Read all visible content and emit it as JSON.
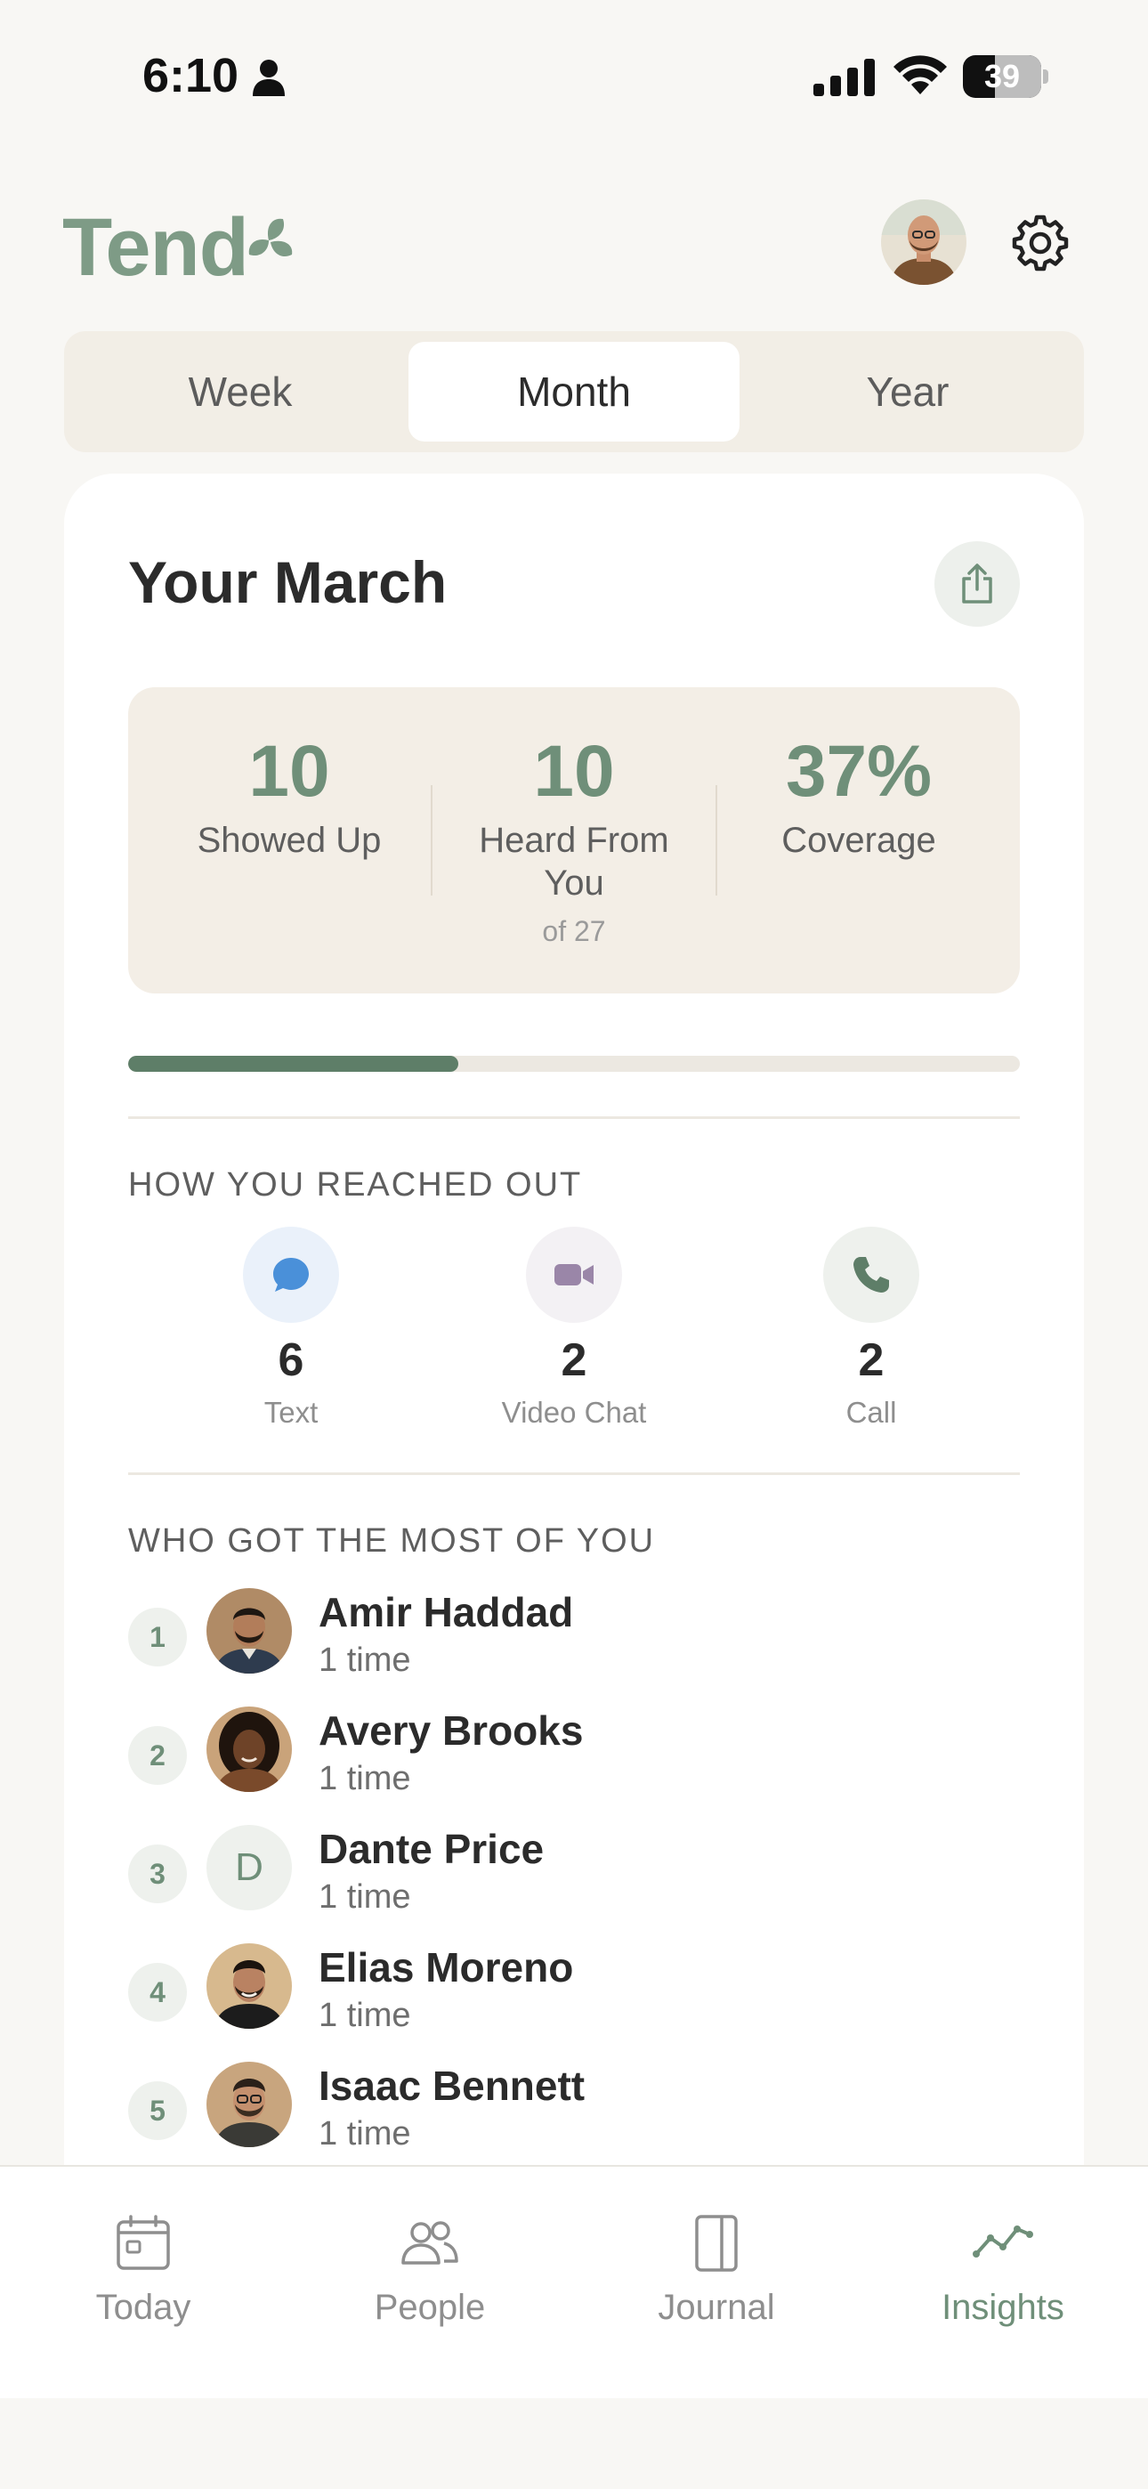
{
  "status_bar": {
    "time": "6:10",
    "battery": "39"
  },
  "header": {
    "logo": "Tend"
  },
  "segments": [
    {
      "label": "Week",
      "active": false
    },
    {
      "label": "Month",
      "active": true
    },
    {
      "label": "Year",
      "active": false
    }
  ],
  "card": {
    "title": "Your March",
    "stats": [
      {
        "value": "10",
        "label": "Showed Up",
        "sub": ""
      },
      {
        "value": "10",
        "label": "Heard From You",
        "sub": "of 27"
      },
      {
        "value": "37%",
        "label": "Coverage",
        "sub": ""
      }
    ],
    "coverage_fraction": 0.37,
    "reach_title": "HOW YOU REACHED OUT",
    "methods": [
      {
        "icon": "message-bubble-icon",
        "count": "6",
        "label": "Text",
        "color": "#4A90D9"
      },
      {
        "icon": "video-camera-icon",
        "count": "2",
        "label": "Video Chat",
        "color": "#9A86A8"
      },
      {
        "icon": "phone-icon",
        "count": "2",
        "label": "Call",
        "color": "#5E7E68"
      }
    ],
    "people_title": "WHO GOT THE MOST OF YOU",
    "people": [
      {
        "rank": "1",
        "name": "Amir Haddad",
        "count": "1 time"
      },
      {
        "rank": "2",
        "name": "Avery Brooks",
        "count": "1 time"
      },
      {
        "rank": "3",
        "name": "Dante Price",
        "count": "1 time",
        "initial": "D"
      },
      {
        "rank": "4",
        "name": "Elias Moreno",
        "count": "1 time"
      },
      {
        "rank": "5",
        "name": "Isaac Bennett",
        "count": "1 time"
      }
    ]
  },
  "tabs": [
    {
      "label": "Today",
      "icon": "calendar-icon",
      "active": false
    },
    {
      "label": "People",
      "icon": "people-icon",
      "active": false
    },
    {
      "label": "Journal",
      "icon": "journal-icon",
      "active": false
    },
    {
      "label": "Insights",
      "icon": "trend-line-icon",
      "active": true
    }
  ],
  "colors": {
    "accent": "#6F8F79",
    "accent_dark": "#5E7E68",
    "background": "#F8F7F4",
    "stats_bg": "#F3EEE6"
  }
}
